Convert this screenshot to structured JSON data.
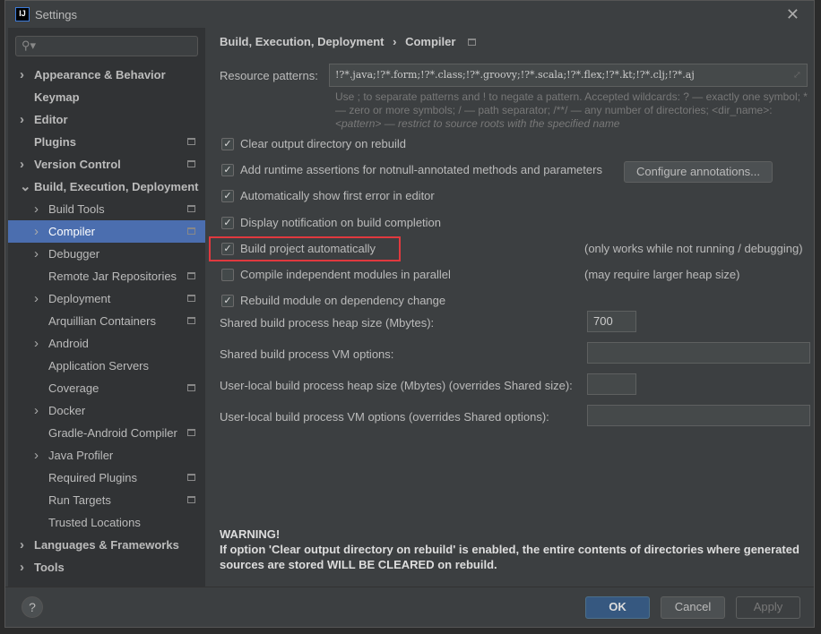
{
  "window": {
    "title": "Settings",
    "logo": "IJ"
  },
  "search": {
    "placeholder": ""
  },
  "sidebar": {
    "items": [
      {
        "label": "Appearance & Behavior",
        "level": 0,
        "expand": "collapsed",
        "icon": false
      },
      {
        "label": "Keymap",
        "level": 0,
        "expand": "none",
        "icon": false
      },
      {
        "label": "Editor",
        "level": 0,
        "expand": "collapsed",
        "icon": false
      },
      {
        "label": "Plugins",
        "level": 0,
        "expand": "none",
        "icon": true
      },
      {
        "label": "Version Control",
        "level": 0,
        "expand": "collapsed",
        "icon": true
      },
      {
        "label": "Build, Execution, Deployment",
        "level": 0,
        "expand": "expanded",
        "icon": false
      },
      {
        "label": "Build Tools",
        "level": 1,
        "expand": "collapsed",
        "icon": true
      },
      {
        "label": "Compiler",
        "level": 1,
        "expand": "collapsed",
        "icon": true,
        "selected": true
      },
      {
        "label": "Debugger",
        "level": 1,
        "expand": "collapsed",
        "icon": false
      },
      {
        "label": "Remote Jar Repositories",
        "level": 1,
        "expand": "none",
        "icon": true
      },
      {
        "label": "Deployment",
        "level": 1,
        "expand": "collapsed",
        "icon": true
      },
      {
        "label": "Arquillian Containers",
        "level": 1,
        "expand": "none",
        "icon": true
      },
      {
        "label": "Android",
        "level": 1,
        "expand": "collapsed",
        "icon": false
      },
      {
        "label": "Application Servers",
        "level": 1,
        "expand": "none",
        "icon": false
      },
      {
        "label": "Coverage",
        "level": 1,
        "expand": "none",
        "icon": true
      },
      {
        "label": "Docker",
        "level": 1,
        "expand": "collapsed",
        "icon": false
      },
      {
        "label": "Gradle-Android Compiler",
        "level": 1,
        "expand": "none",
        "icon": true
      },
      {
        "label": "Java Profiler",
        "level": 1,
        "expand": "collapsed",
        "icon": false
      },
      {
        "label": "Required Plugins",
        "level": 1,
        "expand": "none",
        "icon": true
      },
      {
        "label": "Run Targets",
        "level": 1,
        "expand": "none",
        "icon": true
      },
      {
        "label": "Trusted Locations",
        "level": 1,
        "expand": "none",
        "icon": false
      },
      {
        "label": "Languages & Frameworks",
        "level": 0,
        "expand": "collapsed",
        "icon": false
      },
      {
        "label": "Tools",
        "level": 0,
        "expand": "collapsed",
        "icon": false
      }
    ]
  },
  "breadcrumb": {
    "parent": "Build, Execution, Deployment",
    "sep": "›",
    "current": "Compiler"
  },
  "resource": {
    "label": "Resource patterns:",
    "value": "!?*.java;!?*.form;!?*.class;!?*.groovy;!?*.scala;!?*.flex;!?*.kt;!?*.clj;!?*.aj",
    "hint1": "Use ; to separate patterns and ! to negate a pattern. Accepted wildcards: ? — exactly one symbol; *",
    "hint2": "— zero or more symbols; / — path separator; /**/ — any number of directories; <dir_name>:",
    "hint3": "<pattern> — restrict to source roots with the specified name"
  },
  "options": [
    {
      "label": "Clear output directory on rebuild",
      "checked": true
    },
    {
      "label": "Add runtime assertions for notnull-annotated methods and parameters",
      "checked": true
    },
    {
      "label": "Automatically show first error in editor",
      "checked": true
    },
    {
      "label": "Display notification on build completion",
      "checked": true
    },
    {
      "label": "Build project automatically",
      "checked": true,
      "note": "(only works while not running / debugging)"
    },
    {
      "label": "Compile independent modules in parallel",
      "checked": false,
      "note": "(may require larger heap size)"
    },
    {
      "label": "Rebuild module on dependency change",
      "checked": true
    }
  ],
  "configure_button": "Configure annotations...",
  "fields": [
    {
      "label": "Shared build process heap size (Mbytes):",
      "value": "700"
    },
    {
      "label": "Shared build process VM options:",
      "value": ""
    },
    {
      "label": "User-local build process heap size (Mbytes) (overrides Shared size):",
      "value": ""
    },
    {
      "label": "User-local build process VM options (overrides Shared options):",
      "value": ""
    }
  ],
  "warning": {
    "title": "WARNING!",
    "line1": "If option 'Clear output directory on rebuild' is enabled, the entire contents of directories where generated",
    "line2": "sources are stored WILL BE CLEARED on rebuild."
  },
  "footer": {
    "help": "?",
    "ok": "OK",
    "cancel": "Cancel",
    "apply": "Apply"
  },
  "colors": {
    "selection": "#4b6eaf",
    "highlight": "#e0393e",
    "ok": "#365880"
  }
}
